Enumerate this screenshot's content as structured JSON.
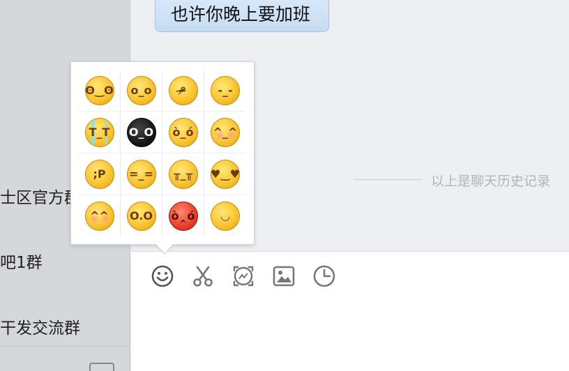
{
  "sidebar": {
    "items": [
      {
        "label": "士区官方群"
      },
      {
        "label": "吧1群"
      },
      {
        "label": "干发交流群"
      }
    ]
  },
  "chat": {
    "message": "也许你晚上要加班",
    "history_label": "以上是聊天历史记录"
  },
  "toolbar": {
    "buttons": [
      {
        "icon": "smiley-icon"
      },
      {
        "icon": "scissors-icon"
      },
      {
        "icon": "screen-capture-icon"
      },
      {
        "icon": "image-icon"
      },
      {
        "icon": "clock-icon"
      }
    ]
  },
  "emoji_panel": {
    "emojis": [
      {
        "name": "grin-emoji",
        "glyph": "ʘ‿ʘ",
        "style": ""
      },
      {
        "name": "worried-emoji",
        "glyph": "o_o",
        "style": ""
      },
      {
        "name": "yawn-emoji",
        "glyph": "ᵒ̴̶̷",
        "style": ""
      },
      {
        "name": "pick-nose-emoji",
        "glyph": "-_-",
        "style": ""
      },
      {
        "name": "cry-emoji",
        "glyph": "T_T",
        "style": "cry"
      },
      {
        "name": "scared-black-emoji",
        "glyph": "O_O",
        "style": "black"
      },
      {
        "name": "angry-stare-emoji",
        "glyph": "ò_ó",
        "style": ""
      },
      {
        "name": "smile-blush-emoji",
        "glyph": "^_^",
        "style": "blush"
      },
      {
        "name": "tongue-wink-emoji",
        "glyph": ";P",
        "style": ""
      },
      {
        "name": "sweat-emoji",
        "glyph": "=_=",
        "style": ""
      },
      {
        "name": "sad-tears-emoji",
        "glyph": "╥_╥",
        "style": ""
      },
      {
        "name": "heart-eyes-emoji",
        "glyph": "♥‿♥",
        "style": ""
      },
      {
        "name": "shy-emoji",
        "glyph": "^^",
        "style": "blush"
      },
      {
        "name": "surprised-emoji",
        "glyph": "O.O",
        "style": ""
      },
      {
        "name": "furious-emoji",
        "glyph": "ò‸ó",
        "style": "red"
      },
      {
        "name": "smile-emoji",
        "glyph": "◡",
        "style": ""
      }
    ]
  }
}
